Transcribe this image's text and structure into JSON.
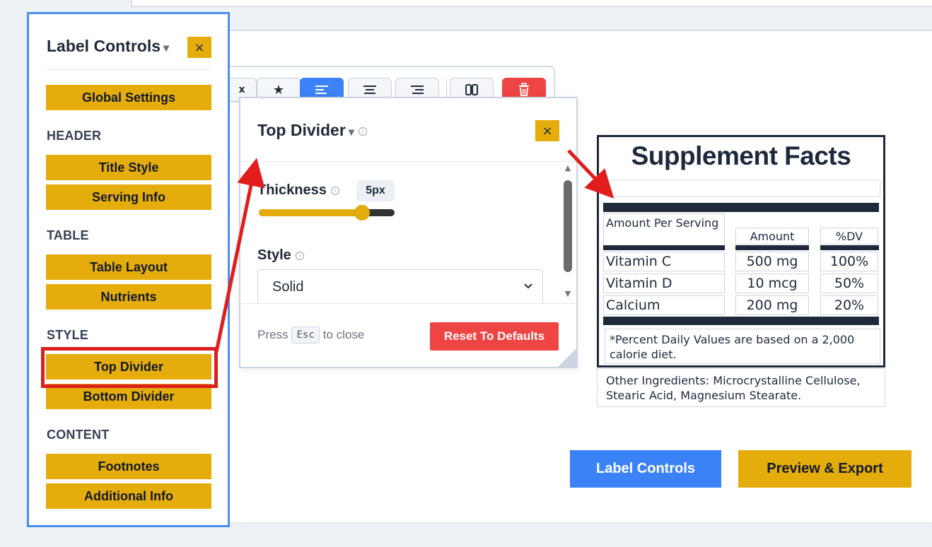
{
  "toolbar": {
    "partial_label": "x",
    "buttons": [
      {
        "name": "favorite",
        "icon": "star-icon",
        "glyph": "★"
      },
      {
        "name": "align-left",
        "icon": "align-left-icon"
      },
      {
        "name": "align-center",
        "icon": "align-center-icon"
      },
      {
        "name": "align-right",
        "icon": "align-right-icon"
      },
      {
        "name": "columns",
        "icon": "columns-icon"
      },
      {
        "name": "delete",
        "icon": "trash-icon"
      }
    ],
    "active": "align-left"
  },
  "sidebar": {
    "title": "Label Controls",
    "caret": "▾",
    "close": "×",
    "global_button": "Global Settings",
    "sections": [
      {
        "heading": "HEADER",
        "items": [
          "Title Style",
          "Serving Info"
        ]
      },
      {
        "heading": "TABLE",
        "items": [
          "Table Layout",
          "Nutrients"
        ]
      },
      {
        "heading": "STYLE",
        "items": [
          "Top Divider",
          "Bottom Divider"
        ]
      },
      {
        "heading": "CONTENT",
        "items": [
          "Footnotes",
          "Additional Info"
        ]
      }
    ],
    "selected": "Top Divider"
  },
  "popup": {
    "title": "Top Divider",
    "caret": "▾",
    "close": "×",
    "thickness_label": "Thickness",
    "thickness_value": "5px",
    "thickness_fraction": 0.76,
    "style_label": "Style",
    "style_value": "Solid",
    "press_text": "Press",
    "esc_key": "Esc",
    "to_close_text": "to close",
    "reset_button": "Reset To Defaults"
  },
  "label": {
    "title": "Supplement Facts",
    "headers": {
      "name": "Amount Per Serving",
      "amount": "Amount",
      "dv": "%DV"
    },
    "rows": [
      {
        "name": "Vitamin C",
        "amount": "500 mg",
        "dv": "100%"
      },
      {
        "name": "Vitamin D",
        "amount": "10 mcg",
        "dv": "50%"
      },
      {
        "name": "Calcium",
        "amount": "200 mg",
        "dv": "20%"
      }
    ],
    "footnote": "*Percent Daily Values are based on a 2,000 calorie diet.",
    "other_ingredients": "Other Ingredients: Microcrystalline Cellulose, Stearic Acid, Magnesium Stearate."
  },
  "buttons": {
    "label_controls": "Label Controls",
    "preview_export": "Preview & Export"
  },
  "colors": {
    "accent_gold": "#e5ad0b",
    "primary_blue": "#3b82f6",
    "danger_red": "#ef4444",
    "annotation_red": "#dc1f1f",
    "label_dark": "#1e293b"
  }
}
